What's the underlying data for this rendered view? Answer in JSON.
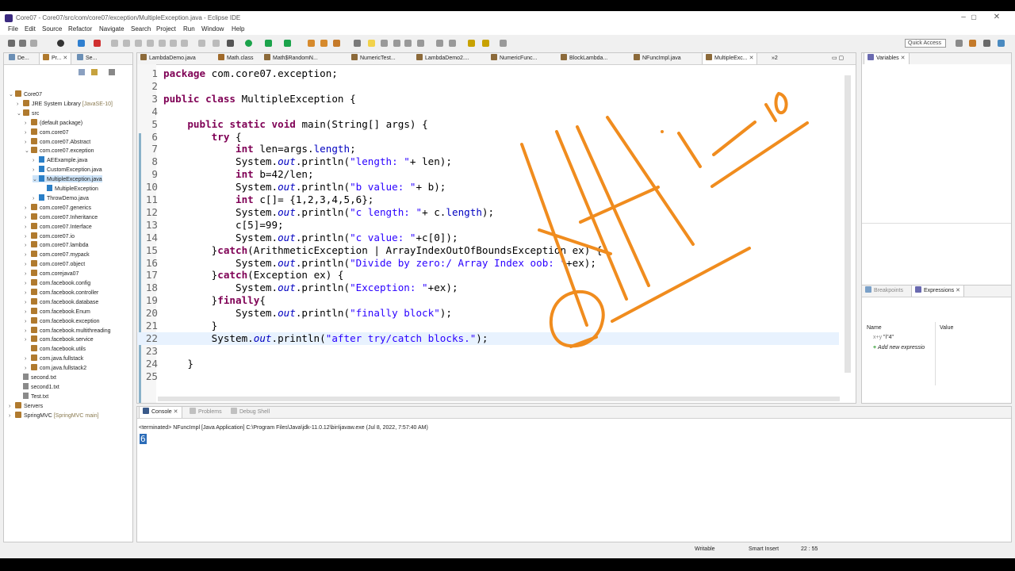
{
  "window": {
    "title": "Core07 - Core07/src/com/core07/exception/MultipleException.java - Eclipse IDE",
    "controls": [
      "–",
      "▢",
      "✕"
    ]
  },
  "menu": [
    "File",
    "Edit",
    "Source",
    "Refactor",
    "Navigate",
    "Search",
    "Project",
    "Run",
    "Window",
    "Help"
  ],
  "toolbar": {
    "quick_access": "Quick Access"
  },
  "explorer": {
    "tabs": [
      "De...",
      "Pr...",
      "Se..."
    ],
    "items": [
      {
        "label": "Core07",
        "kind": "project",
        "indent": 0,
        "arrow": "⌄"
      },
      {
        "label": "JRE System Library",
        "extra": "[JavaSE-10]",
        "kind": "lib",
        "indent": 1,
        "arrow": "›"
      },
      {
        "label": "src",
        "kind": "src",
        "indent": 1,
        "arrow": "⌄"
      },
      {
        "label": "(default package)",
        "kind": "pkg",
        "indent": 2,
        "arrow": "›"
      },
      {
        "label": "com.core07",
        "kind": "pkg",
        "indent": 2,
        "arrow": "›"
      },
      {
        "label": "com.core07.Abstract",
        "kind": "pkg",
        "indent": 2,
        "arrow": "›"
      },
      {
        "label": "com.core07.exception",
        "kind": "pkg",
        "indent": 2,
        "arrow": "⌄"
      },
      {
        "label": "AEExample.java",
        "kind": "file",
        "indent": 3,
        "arrow": "›"
      },
      {
        "label": "CustomException.java",
        "kind": "file",
        "indent": 3,
        "arrow": "›"
      },
      {
        "label": "MultipleException.java",
        "kind": "file",
        "indent": 3,
        "arrow": "⌄",
        "selected": true
      },
      {
        "label": "MultipleException",
        "kind": "class",
        "indent": 4,
        "arrow": ""
      },
      {
        "label": "ThrowDemo.java",
        "kind": "file",
        "indent": 3,
        "arrow": "›"
      },
      {
        "label": "com.core07.generics",
        "kind": "pkg",
        "indent": 2,
        "arrow": "›"
      },
      {
        "label": "com.core07.Inheritance",
        "kind": "pkg",
        "indent": 2,
        "arrow": "›"
      },
      {
        "label": "com.core07.Interface",
        "kind": "pkg",
        "indent": 2,
        "arrow": "›"
      },
      {
        "label": "com.core07.io",
        "kind": "pkg",
        "indent": 2,
        "arrow": "›"
      },
      {
        "label": "com.core07.lambda",
        "kind": "pkg",
        "indent": 2,
        "arrow": "›"
      },
      {
        "label": "com.core07.mypack",
        "kind": "pkg",
        "indent": 2,
        "arrow": "›"
      },
      {
        "label": "com.core07.object",
        "kind": "pkg",
        "indent": 2,
        "arrow": "›"
      },
      {
        "label": "com.corejava07",
        "kind": "pkg",
        "indent": 2,
        "arrow": "›"
      },
      {
        "label": "com.facebook.config",
        "kind": "pkg",
        "indent": 2,
        "arrow": "›"
      },
      {
        "label": "com.facebook.controller",
        "kind": "pkg",
        "indent": 2,
        "arrow": "›"
      },
      {
        "label": "com.facebook.database",
        "kind": "pkg",
        "indent": 2,
        "arrow": "›"
      },
      {
        "label": "com.facebook.Enum",
        "kind": "pkg",
        "indent": 2,
        "arrow": "›"
      },
      {
        "label": "com.facebook.exception",
        "kind": "pkg",
        "indent": 2,
        "arrow": "›"
      },
      {
        "label": "com.facebook.multithreading",
        "kind": "pkg",
        "indent": 2,
        "arrow": "›"
      },
      {
        "label": "com.facebook.service",
        "kind": "pkg",
        "indent": 2,
        "arrow": "›"
      },
      {
        "label": "com.facebook.utils",
        "kind": "pkg",
        "indent": 2,
        "arrow": ""
      },
      {
        "label": "com.java.fullstack",
        "kind": "pkg",
        "indent": 2,
        "arrow": "›"
      },
      {
        "label": "com.java.fullstack2",
        "kind": "pkg",
        "indent": 2,
        "arrow": "›"
      },
      {
        "label": "second.txt",
        "kind": "txt",
        "indent": 1,
        "arrow": ""
      },
      {
        "label": "second1.txt",
        "kind": "txt",
        "indent": 1,
        "arrow": ""
      },
      {
        "label": "Test.txt",
        "kind": "txt",
        "indent": 1,
        "arrow": ""
      },
      {
        "label": "Servers",
        "kind": "project",
        "indent": 0,
        "arrow": "›"
      },
      {
        "label": "SpringMVC",
        "extra": "[SpringMVC main]",
        "kind": "project",
        "indent": 0,
        "arrow": "›"
      }
    ]
  },
  "editor": {
    "tabs": [
      "LambdaDemo.java",
      "Math.class",
      "Math$RandomN...",
      "NumericTest...",
      "LambdaDemo2....",
      "NumericFunc...",
      "BlockLambda...",
      "NFuncImpl.java",
      "MultipleExc..."
    ],
    "overflow": "»2",
    "lines": [
      {
        "n": "1",
        "t": "package com.core07.exception;"
      },
      {
        "n": "2",
        "t": ""
      },
      {
        "n": "3",
        "t": "public class MultipleException {"
      },
      {
        "n": "4",
        "t": ""
      },
      {
        "n": "5",
        "t": "    public static void main(String[] args) {"
      },
      {
        "n": "6",
        "t": "        try {"
      },
      {
        "n": "7",
        "t": "            int len=args.length;"
      },
      {
        "n": "8",
        "t": "            System.out.println(\"length: \"+ len);"
      },
      {
        "n": "9",
        "t": "            int b=42/len;"
      },
      {
        "n": "10",
        "t": "            System.out.println(\"b value: \"+ b);"
      },
      {
        "n": "11",
        "t": "            int c[]= {1,2,3,4,5,6};"
      },
      {
        "n": "12",
        "t": "            System.out.println(\"c length: \"+ c.length);"
      },
      {
        "n": "13",
        "t": "            c[5]=99;"
      },
      {
        "n": "14",
        "t": "            System.out.println(\"c value: \"+c[0]);"
      },
      {
        "n": "15",
        "t": "        }catch(ArithmeticException | ArrayIndexOutOfBoundsException ex) {"
      },
      {
        "n": "16",
        "t": "            System.out.println(\"Divide by zero:/ Array Index oob: \"+ex);"
      },
      {
        "n": "17",
        "t": "        }catch(Exception ex) {"
      },
      {
        "n": "18",
        "t": "            System.out.println(\"Exception: \"+ex);"
      },
      {
        "n": "19",
        "t": "        }finally{"
      },
      {
        "n": "20",
        "t": "            System.out.println(\"finally block\");"
      },
      {
        "n": "21",
        "t": "        }"
      },
      {
        "n": "22",
        "t": "        System.out.println(\"after try/catch blocks.\");"
      },
      {
        "n": "23",
        "t": ""
      },
      {
        "n": "24",
        "t": "    }"
      },
      {
        "n": "25",
        "t": ""
      }
    ],
    "current_line": "22"
  },
  "variables": {
    "tab": "Variables"
  },
  "expressions": {
    "tabs": [
      "Breakpoints",
      "Expressions"
    ],
    "columns": [
      "Name",
      "Value"
    ],
    "rows": [
      "\"i\"4\"",
      "Add new expressio"
    ]
  },
  "console": {
    "tabs": [
      "Console",
      "Problems",
      "Debug Shell"
    ],
    "terminated": "<terminated> NFuncImpl [Java Application] C:\\Program Files\\Java\\jdk-11.0.12\\bin\\javaw.exe (Jul 8, 2022, 7:57:40 AM)",
    "output": "6"
  },
  "statusbar": {
    "writable": "Writable",
    "mode": "Smart Insert",
    "position": "22 : 55"
  },
  "colors": {
    "annotation": "#f08c1e",
    "keyword": "#7f0055",
    "string": "#2a00ff",
    "field": "#0000c0"
  }
}
